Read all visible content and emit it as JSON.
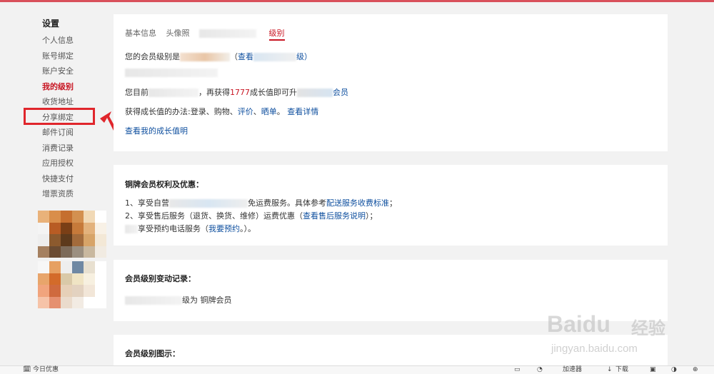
{
  "sidebar": {
    "title": "设置",
    "items": [
      {
        "label": "个人信息"
      },
      {
        "label": "账号绑定"
      },
      {
        "label": "账户安全"
      },
      {
        "label": "我的级别"
      },
      {
        "label": "收货地址"
      },
      {
        "label": "分享绑定"
      },
      {
        "label": "邮件订阅"
      },
      {
        "label": "消费记录"
      },
      {
        "label": "应用授权"
      },
      {
        "label": "快捷支付"
      },
      {
        "label": "增票资质"
      }
    ]
  },
  "tabs": [
    {
      "label": "基本信息"
    },
    {
      "label": "头像照"
    },
    {
      "label": "级别"
    }
  ],
  "level_card": {
    "line1_prefix": "您的会员级别是",
    "line1_link": "查看",
    "line1_suffix": "级）",
    "line3_a": "您目前",
    "line3_b": "，再获得",
    "line3_num": "1777",
    "line3_c": "成长值即可升",
    "line3_d": "会员",
    "line4_text": "获得成长值的办法:登录、购物、",
    "line4_eval": "评价",
    "line4_sep": "、",
    "line4_share": "晒单",
    "line4_end": "。",
    "line4_link": "查看详情",
    "line5_link": "查看我的成长值明"
  },
  "benefits": {
    "title": "铜牌会员权利及优惠：",
    "item1_a": "1、享受自营",
    "item1_b": "免运费服务。具体参考",
    "item1_link": "配送服务收费标准",
    "item1_end": "；",
    "item2_a": "2、享受售后服务（退货、换货、维修）运费优惠（",
    "item2_link": "查看售后服务说明",
    "item2_end": "）；",
    "item3_a": "享受预约电话服务（",
    "item3_link": "我要预约",
    "item3_end": "。）。"
  },
  "history": {
    "title": "会员级别变动记录：",
    "entry": "级为 铜牌会员"
  },
  "diagram": {
    "title": "会员级别图示："
  },
  "statusbar": {
    "today": "今日优惠",
    "speed": "加速器",
    "download": "下载"
  },
  "watermark": {
    "brand": "Baidu",
    "cn": "经验",
    "url": "jingyan.baidu.com"
  },
  "colors": {
    "accent": "#c81623",
    "link": "#0d4e9e",
    "highlight": "#e0262c"
  }
}
